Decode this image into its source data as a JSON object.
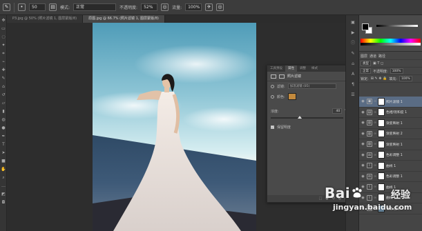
{
  "options_bar": {
    "mode_label": "模式:",
    "mode_value": "正常",
    "opacity_label": "不透明度:",
    "opacity_value": "52%",
    "flow_label": "流量:",
    "flow_value": "100%",
    "brush_size": "50"
  },
  "tabs": [
    {
      "label": "P3.jpg @ 50% (照片滤镜 1, 图层蒙版/8)"
    },
    {
      "label": "原图.jpg @ 66.7% (照片滤镜 1, 图层蒙版/8)"
    }
  ],
  "properties": {
    "tabs": [
      "工具预设",
      "属性",
      "调整",
      "样式"
    ],
    "title": "照片滤镜",
    "filter_label": "滤镜:",
    "filter_value": "加温滤镜 (85)",
    "color_label": "颜色:",
    "color_swatch": "#c38a3d",
    "density_label": "浓度:",
    "density_value": "40",
    "density_unit": "%",
    "density_fraction": 0.4,
    "preserve_label": "保留明度",
    "preserve_checked": true
  },
  "layers_panel": {
    "tabs": [
      "图层",
      "通道",
      "路径"
    ],
    "kind_label": "类型",
    "blend_mode": "正常",
    "opacity_label": "不透明度:",
    "opacity_value": "100%",
    "lock_label": "锁定:",
    "fill_label": "填充:",
    "fill_value": "100%",
    "layers": [
      {
        "name": "照片滤镜 1",
        "selected": true
      },
      {
        "name": "色相/饱和度 1",
        "selected": false
      },
      {
        "name": "渐变映射 1",
        "selected": false
      },
      {
        "name": "渐变映射 2",
        "selected": false
      },
      {
        "name": "渐变映射 1",
        "selected": false
      },
      {
        "name": "色彩调整 1",
        "selected": false
      },
      {
        "name": "曲线 1",
        "selected": false
      },
      {
        "name": "色彩调整 1",
        "selected": false
      },
      {
        "name": "曲线 1",
        "selected": false
      },
      {
        "name": "曲线 1",
        "selected": false
      },
      {
        "name": "背景 副本",
        "selected": false
      }
    ]
  },
  "watermark": {
    "brand": "Bai",
    "brand_suffix": "经验",
    "cn": "经验",
    "url": "jingyan.baidu.com"
  }
}
